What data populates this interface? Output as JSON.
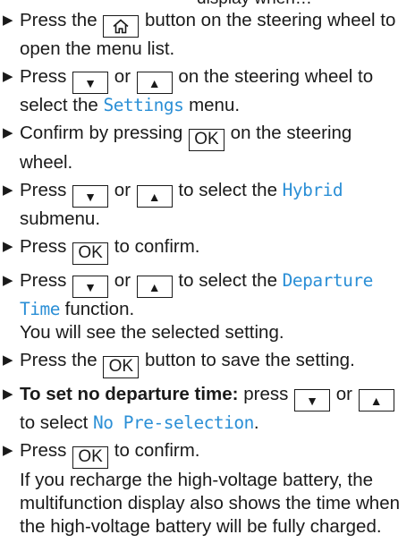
{
  "header_fragment": "display when…",
  "keys": {
    "down": "▼",
    "up": "▲",
    "ok": "OK",
    "home_icon": "home-icon"
  },
  "steps": [
    {
      "p1": "Press the ",
      "p2": " button on the steering wheel to open the menu list."
    },
    {
      "p1": "Press ",
      "or": " or ",
      "p2": " on the steering wheel to select the ",
      "menu": "Settings",
      "p3": " menu."
    },
    {
      "p1": "Confirm by pressing ",
      "p2": " on the steering wheel."
    },
    {
      "p1": "Press ",
      "or": " or ",
      "p2": " to select the ",
      "menu": "Hybrid",
      "p3": " submenu."
    },
    {
      "p1": "Press ",
      "p2": " to confirm."
    },
    {
      "p1": "Press ",
      "or": " or ",
      "p2": " to select the ",
      "menu": "Departure Time",
      "p3": " function.",
      "note": "You will see the selected setting."
    },
    {
      "p1": "Press the ",
      "p2": " button to save the setting."
    },
    {
      "bold": "To set no departure time:",
      "p1": " press ",
      "or": " or ",
      "p2": " to select ",
      "menu": "No Pre-selection",
      "p3": "."
    },
    {
      "p1": "Press ",
      "p2": " to confirm.",
      "note": "If you recharge the high-voltage battery, the multifunction display also shows the time when the high-voltage battery will be fully charged."
    }
  ]
}
